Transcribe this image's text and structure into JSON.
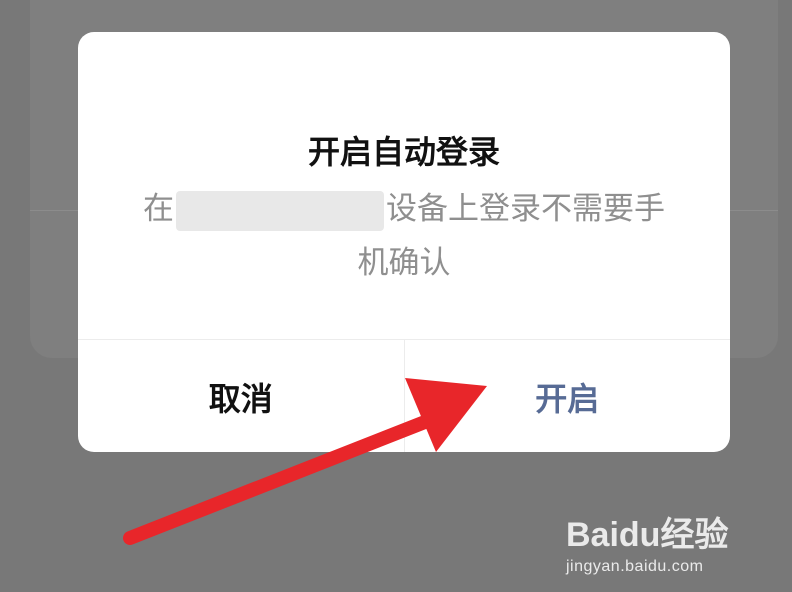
{
  "dialog": {
    "title": "开启自动登录",
    "message_prefix": "在",
    "message_suffix": "设备上登录不需要手机确认",
    "cancel_label": "取消",
    "confirm_label": "开启"
  },
  "watermark": {
    "logo_text": "Baidu经验",
    "url": "jingyan.baidu.com"
  },
  "colors": {
    "overlay": "#787878",
    "confirm": "#576b95",
    "arrow": "#e8262a"
  }
}
